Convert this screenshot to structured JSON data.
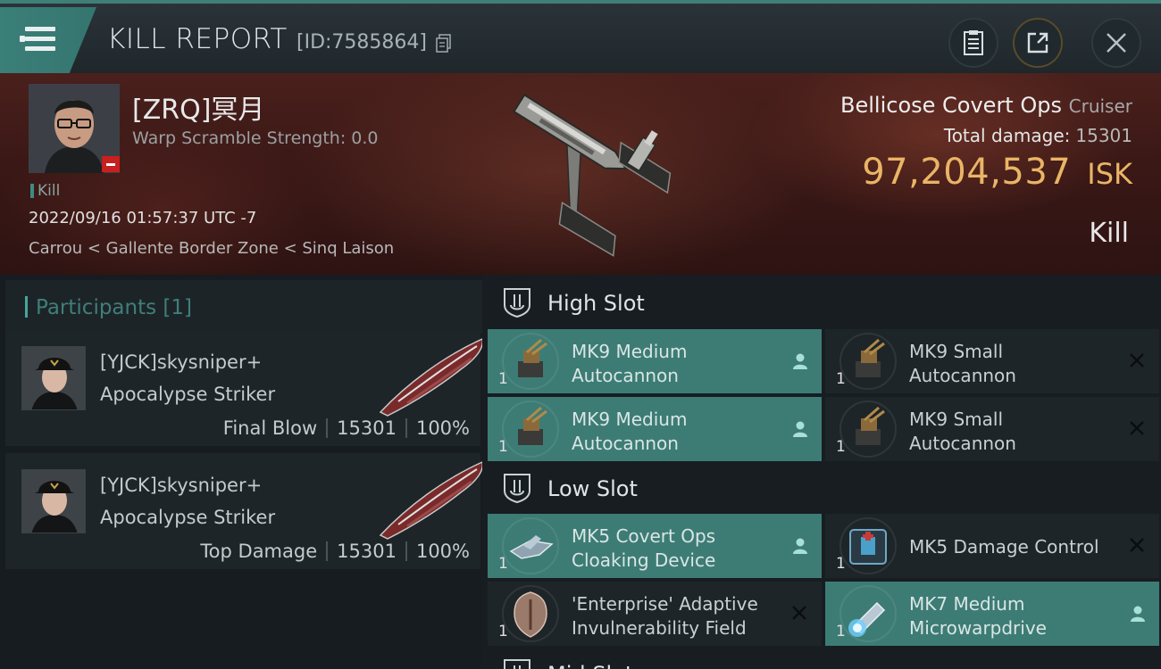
{
  "header": {
    "title": "KILL REPORT",
    "report_id": "[ID:7585864]"
  },
  "victim": {
    "name": "[ZRQ]冥月",
    "warp_scramble": "Warp Scramble Strength: 0.0",
    "tag": "Kill",
    "datetime": "2022/09/16 01:57:37 UTC -7",
    "location": "Carrou < Gallente Border Zone < Sinq Laison",
    "ship_name": "Bellicose Covert Ops",
    "ship_class": "Cruiser",
    "total_damage_label": "Total damage:",
    "total_damage": "15301",
    "isk_value": "97,204,537",
    "isk_unit": "ISK",
    "result": "Kill"
  },
  "participants": {
    "header": "Participants [1]",
    "items": [
      {
        "name": "[YJCK]skysniper+",
        "ship": "Apocalypse Striker",
        "role": "Final Blow",
        "damage": "15301",
        "percent": "100%"
      },
      {
        "name": "[YJCK]skysniper+",
        "ship": "Apocalypse Striker",
        "role": "Top Damage",
        "damage": "15301",
        "percent": "100%"
      }
    ]
  },
  "slots": {
    "high": {
      "label": "High Slot",
      "modules": [
        {
          "line1": "MK9 Medium",
          "line2": "Autocannon",
          "qty": "1",
          "fitted": true
        },
        {
          "line1": "MK9 Small",
          "line2": "Autocannon",
          "qty": "1",
          "fitted": false
        },
        {
          "line1": "MK9 Medium",
          "line2": "Autocannon",
          "qty": "1",
          "fitted": true
        },
        {
          "line1": "MK9 Small",
          "line2": "Autocannon",
          "qty": "1",
          "fitted": false
        }
      ]
    },
    "low": {
      "label": "Low Slot",
      "modules": [
        {
          "line1": "MK5 Covert Ops",
          "line2": "Cloaking Device",
          "qty": "1",
          "fitted": true
        },
        {
          "line1": "MK5 Damage Control",
          "line2": "",
          "qty": "1",
          "fitted": false
        },
        {
          "line1": "'Enterprise' Adaptive",
          "line2": "Invulnerability Field",
          "qty": "1",
          "fitted": false
        },
        {
          "line1": "MK7 Medium",
          "line2": "Microwarpdrive",
          "qty": "1",
          "fitted": true
        }
      ]
    },
    "mid": {
      "label": "Mid Slot"
    }
  },
  "colors": {
    "accent_teal": "#3d7c75",
    "isk_gold": "#e9b566",
    "banner_red": "#3a1816",
    "status_red": "#c81f1f"
  }
}
